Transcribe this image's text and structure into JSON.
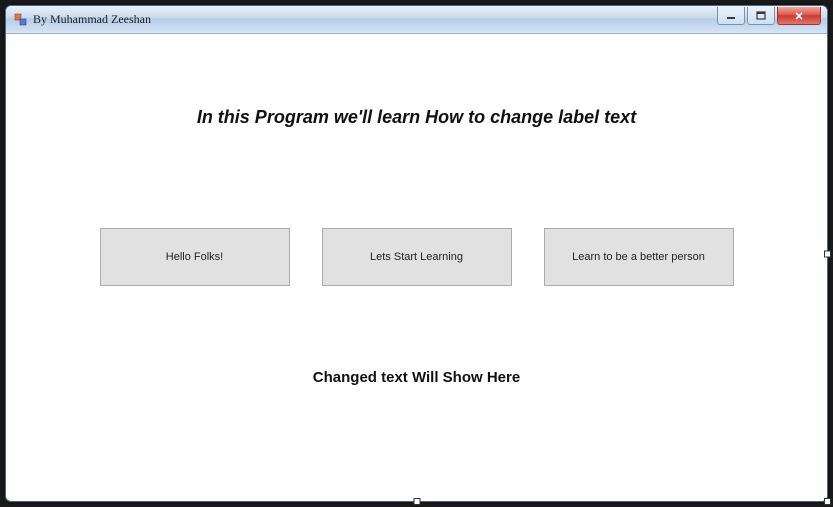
{
  "titlebar": {
    "title": "By Muhammad Zeeshan"
  },
  "heading": "In this Program we'll learn How to change label text",
  "buttons": {
    "b1": "Hello Folks!",
    "b2": "Lets Start Learning",
    "b3": "Learn to be a better person"
  },
  "output_label": "Changed text Will Show Here"
}
